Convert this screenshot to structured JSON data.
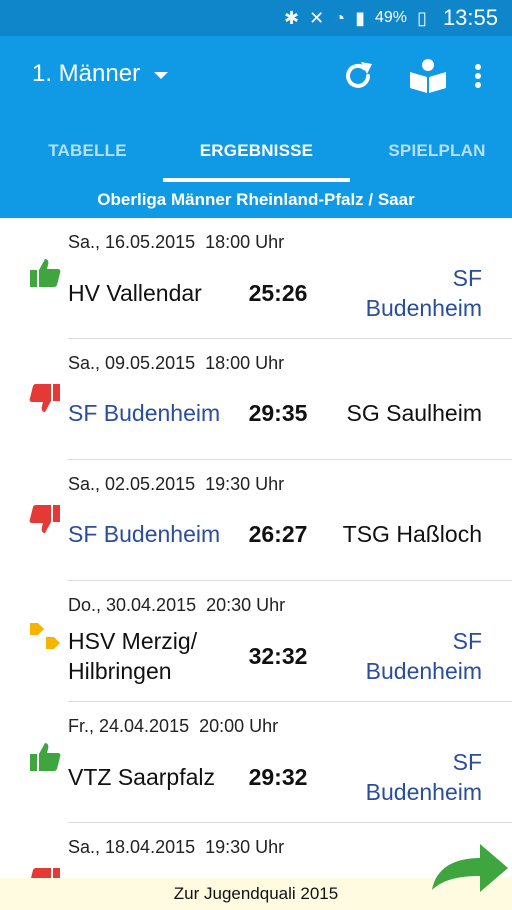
{
  "status": {
    "battery": "49%",
    "time": "13:55"
  },
  "toolbar": {
    "title": "1. Männer"
  },
  "tabs": [
    {
      "label": "TABELLE"
    },
    {
      "label": "ERGEBNISSE"
    },
    {
      "label": "SPIELPLAN"
    }
  ],
  "league": "Oberliga Männer Rheinland-Pfalz / Saar",
  "colors": {
    "toolbar": "#109ae5",
    "statusbar": "#0f86c9",
    "win": "#3ea53f",
    "loss": "#e53935",
    "draw": "#f4b400",
    "club": "#2a4e9c"
  },
  "matches": [
    {
      "date": "Sa., 16.05.2015  18:00 Uhr",
      "home_lines": [
        "HV Vallendar"
      ],
      "score": "25:26",
      "away_lines": [
        "SF",
        "Budenheim"
      ],
      "result": "win",
      "icon": "thumbs-up-icon",
      "home_club": false,
      "away_club": true
    },
    {
      "date": "Sa., 09.05.2015  18:00 Uhr",
      "home_lines": [
        "SF Budenheim"
      ],
      "score": "29:35",
      "away_lines": [
        "SG Saulheim"
      ],
      "result": "loss",
      "icon": "thumbs-down-icon",
      "home_club": true,
      "away_club": false
    },
    {
      "date": "Sa., 02.05.2015  19:30 Uhr",
      "home_lines": [
        "SF Budenheim"
      ],
      "score": "26:27",
      "away_lines": [
        "TSG Haßloch"
      ],
      "result": "loss",
      "icon": "thumbs-down-icon",
      "home_club": true,
      "away_club": false
    },
    {
      "date": "Do., 30.04.2015  20:30 Uhr",
      "home_lines": [
        "HSV Merzig/",
        "Hilbringen"
      ],
      "score": "32:32",
      "away_lines": [
        "SF",
        "Budenheim"
      ],
      "result": "draw",
      "icon": "thumbs-sideways-icon",
      "home_club": false,
      "away_club": true
    },
    {
      "date": "Fr., 24.04.2015  20:00 Uhr",
      "home_lines": [
        "VTZ Saarpfalz"
      ],
      "score": "29:32",
      "away_lines": [
        "SF",
        "Budenheim"
      ],
      "result": "win",
      "icon": "thumbs-up-icon",
      "home_club": false,
      "away_club": true
    },
    {
      "date": "Sa., 18.04.2015  19:30 Uhr",
      "home_lines": [],
      "score": "",
      "away_lines": [],
      "result": "loss",
      "icon": "thumbs-down-icon",
      "home_club": false,
      "away_club": false
    }
  ],
  "bottom_link": "Zur Jugendquali 2015"
}
